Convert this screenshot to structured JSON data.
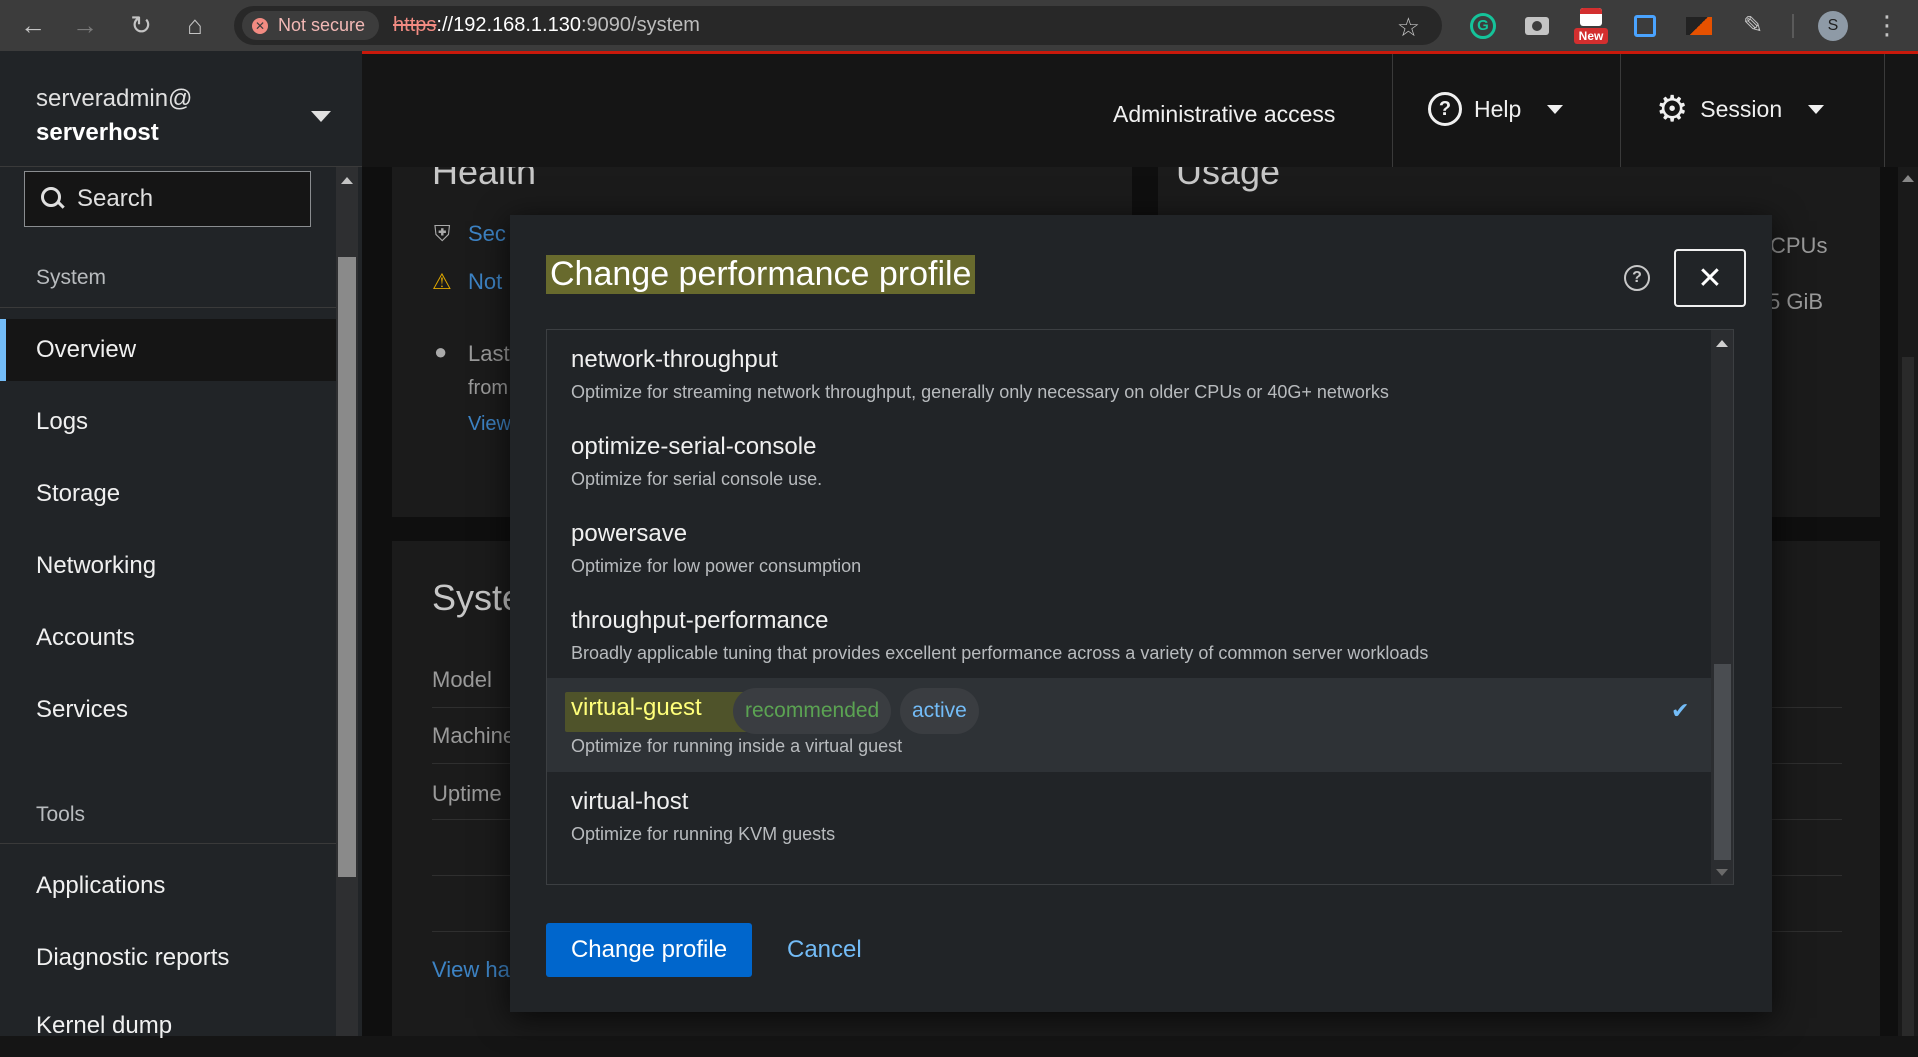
{
  "browser": {
    "security_label": "Not secure",
    "url_scheme": "https",
    "url_host": "://192.168.1.130",
    "url_rest": ":9090/system",
    "ext_new_label": "New",
    "profile_initial": "S"
  },
  "sidebar": {
    "host_user": "serveradmin@",
    "host_name": "serverhost",
    "search_placeholder": "Search",
    "system_label": "System",
    "tools_label": "Tools",
    "items": [
      {
        "label": "Overview"
      },
      {
        "label": "Logs"
      },
      {
        "label": "Storage"
      },
      {
        "label": "Networking"
      },
      {
        "label": "Accounts"
      },
      {
        "label": "Services"
      }
    ],
    "tools_items": [
      {
        "label": "Applications"
      },
      {
        "label": "Diagnostic reports"
      },
      {
        "label": "Kernel dump"
      }
    ]
  },
  "masthead": {
    "admin_access": "Administrative access",
    "help": "Help",
    "session": "Session"
  },
  "background": {
    "health_title": "Health",
    "usage_title": "Usage",
    "sec_link": "Sec",
    "not_link": "Not",
    "last_text": "Last",
    "from_text": "from",
    "view_link": "View",
    "cpus": "CPUs",
    "gib": "5 GiB",
    "system_title": "Syste",
    "model": "Model",
    "machine": "Machine",
    "uptime": "Uptime",
    "view_hw": "View ha"
  },
  "modal": {
    "title": "Change performance profile",
    "profiles": [
      {
        "name": "network-throughput",
        "desc": "Optimize for streaming network throughput, generally only necessary on older CPUs or 40G+ networks"
      },
      {
        "name": "optimize-serial-console",
        "desc": "Optimize for serial console use."
      },
      {
        "name": "powersave",
        "desc": "Optimize for low power consumption"
      },
      {
        "name": "throughput-performance",
        "desc": "Broadly applicable tuning that provides excellent performance across a variety of common server workloads"
      },
      {
        "name": "virtual-guest",
        "desc": "Optimize for running inside a virtual guest",
        "badge_recommended": "recommended",
        "badge_active": "active",
        "selected": true
      },
      {
        "name": "virtual-host",
        "desc": "Optimize for running KVM guests"
      }
    ],
    "primary_button": "Change profile",
    "cancel_button": "Cancel"
  },
  "colors": {
    "accent": "#0066cc",
    "link": "#73bcf7",
    "masthead_border": "#c9190b",
    "recommended": "#5ba352"
  }
}
